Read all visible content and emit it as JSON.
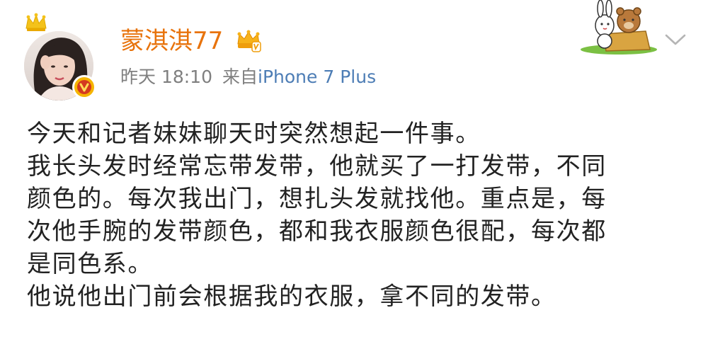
{
  "user": {
    "name": "蒙淇淇77"
  },
  "meta": {
    "time": "昨天 18:10",
    "source_prefix": "来自",
    "device": "iPhone 7 Plus"
  },
  "icons": {
    "crown": "crown-icon",
    "vip": "vip-crown-icon",
    "verified": "verified-badge-icon",
    "dropdown": "chevron-down-icon",
    "sticker": "rabbit-bear-sticker"
  },
  "colors": {
    "username": "#e8730c",
    "device_link": "#4d7db5",
    "meta_text": "#7f7f7f",
    "body_text": "#222222",
    "badge": "#f5b400"
  },
  "content": {
    "lines": [
      "今天和记者妹妹聊天时突然想起一件事。",
      "我长头发时经常忘带发带，他就买了一打发带，不同",
      "颜色的。每次我出门，想扎头发就找他。重点是，每",
      "次他手腕的发带颜色，都和我衣服颜色很配，每次都",
      "是同色系。",
      "他说他出门前会根据我的衣服，拿不同的发带。"
    ]
  }
}
